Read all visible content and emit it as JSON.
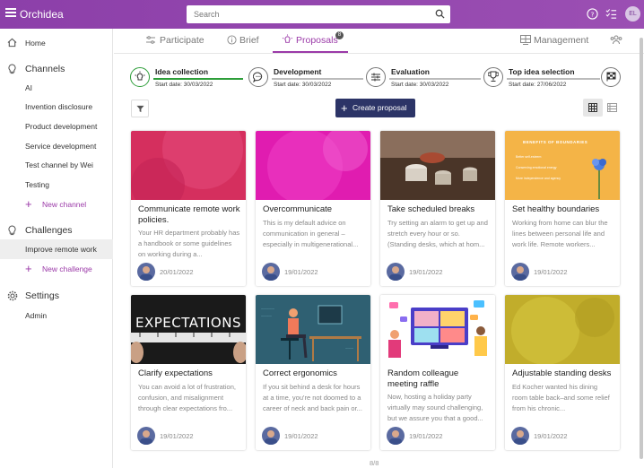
{
  "app": {
    "title": "Orchidea"
  },
  "search": {
    "placeholder": "Search"
  },
  "user": {
    "initials": "EL"
  },
  "sidebar": {
    "home": "Home",
    "channels_header": "Channels",
    "channels": [
      "AI",
      "Invention disclosure",
      "Product development",
      "Service development",
      "Test channel by Wei",
      "Testing"
    ],
    "new_channel": "New channel",
    "challenges_header": "Challenges",
    "challenges": [
      "Improve remote work"
    ],
    "new_challenge": "New challenge",
    "settings_header": "Settings",
    "settings": [
      "Admin"
    ]
  },
  "tabs": {
    "participate": "Participate",
    "brief": "Brief",
    "proposals": "Proposals",
    "proposals_badge": "8",
    "management": "Management"
  },
  "stages": [
    {
      "name": "Idea collection",
      "date": "Start date: 30/03/2022",
      "icon": "lightbulb-icon",
      "active": true
    },
    {
      "name": "Development",
      "date": "Start date: 30/03/2022",
      "icon": "chat-icon",
      "active": false
    },
    {
      "name": "Evaluation",
      "date": "Start date: 30/03/2022",
      "icon": "sliders-icon",
      "active": false
    },
    {
      "name": "Top idea selection",
      "date": "Start date: 27/06/2022",
      "icon": "trophy-icon",
      "active": false
    }
  ],
  "toolbar": {
    "create_label": "Create proposal"
  },
  "cards": [
    {
      "title": "Communicate remote work policies.",
      "desc": "Your HR department probably has a handbook or some guidelines on working during a...",
      "date": "20/01/2022",
      "image": "pink-abstract"
    },
    {
      "title": "Overcommunicate",
      "desc": "This is my default advice on communication in general – especially in multigenerational...",
      "date": "19/01/2022",
      "image": "magenta-abstract"
    },
    {
      "title": "Take scheduled breaks",
      "desc": "Try setting an alarm to get up and stretch every hour or so. (Standing desks, which at hom...",
      "date": "19/01/2022",
      "image": "coffee-cups-photo"
    },
    {
      "title": "Set healthy boundaries",
      "desc": "Working from home can blur the lines between personal life and work life. Remote workers...",
      "date": "19/01/2022",
      "image": "boundaries-infographic"
    },
    {
      "title": "Clarify expectations",
      "desc": "You can avoid a lot of frustration, confusion, and misalignment through clear expectations fro...",
      "date": "19/01/2022",
      "image": "expectations-tape"
    },
    {
      "title": "Correct ergonomics",
      "desc": "If you sit behind a desk for hours at a time, you're not doomed to a career of neck and back pain or...",
      "date": "19/01/2022",
      "image": "ergonomics-illustration"
    },
    {
      "title": "Random colleague meeting raffle",
      "desc": "Now, hosting a holiday party virtually may sound challenging, but we assure you that a good...",
      "date": "19/01/2022",
      "image": "video-call-illustration"
    },
    {
      "title": "Adjustable standing desks",
      "desc": "Ed Kocher wanted his dining room table back–and some relief from his chronic...",
      "date": "19/01/2022",
      "image": "olive-abstract"
    }
  ],
  "boundaries_image": {
    "heading": "BENEFITS OF BOUNDARIES",
    "items": [
      "Better self-esteem",
      "Conserving emotional energy",
      "More independence and agency"
    ]
  },
  "expectations_image": {
    "text": "EXPECTATIONS"
  },
  "pager": "8/8",
  "colors": {
    "brand": "#9b3aa8",
    "topbar": "#8c3fa9",
    "button": "#2c3467",
    "active_stage": "#2e9e3a"
  }
}
